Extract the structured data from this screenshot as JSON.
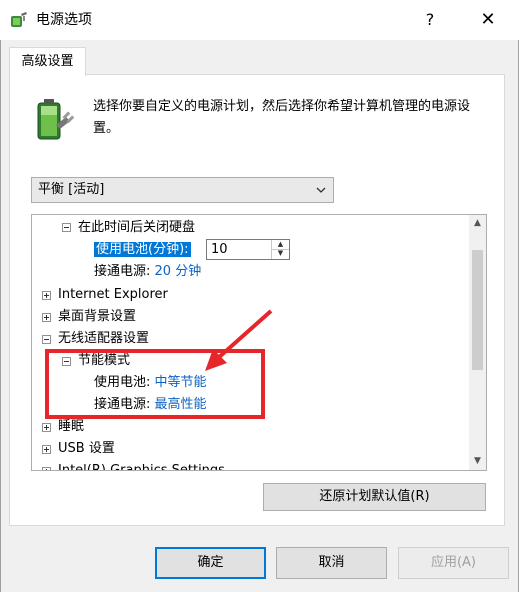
{
  "window": {
    "title": "电源选项",
    "help_glyph": "?",
    "close_glyph": "✕"
  },
  "tabs": [
    {
      "label": "高级设置",
      "active": true
    }
  ],
  "description": "选择你要自定义的电源计划，然后选择你希望计算机管理的电源设置。",
  "plan_select": {
    "value": "平衡 [活动]"
  },
  "tree": {
    "hard_disk": {
      "label": "在此时间后关闭硬盘",
      "battery_label": "使用电池(分钟):",
      "battery_value": "10",
      "plugged_label": "接通电源:",
      "plugged_value": "20 分钟"
    },
    "items": {
      "internet_explorer": "Internet Explorer",
      "desktop_background": "桌面背景设置",
      "wireless_adapter": "无线适配器设置",
      "sleep": "睡眠",
      "usb": "USB 设置",
      "intel_graphics": "Intel(R) Graphics Settings"
    },
    "power_saving": {
      "label": "节能模式",
      "battery_label": "使用电池:",
      "battery_value": "中等节能",
      "plugged_label": "接通电源:",
      "plugged_value": "最高性能"
    }
  },
  "buttons": {
    "restore": "还原计划默认值(R)",
    "ok": "确定",
    "cancel": "取消",
    "apply": "应用(A)"
  },
  "colors": {
    "value_link": "#0b63c4",
    "selection": "#0078d7",
    "annotation": "#e5262b"
  }
}
